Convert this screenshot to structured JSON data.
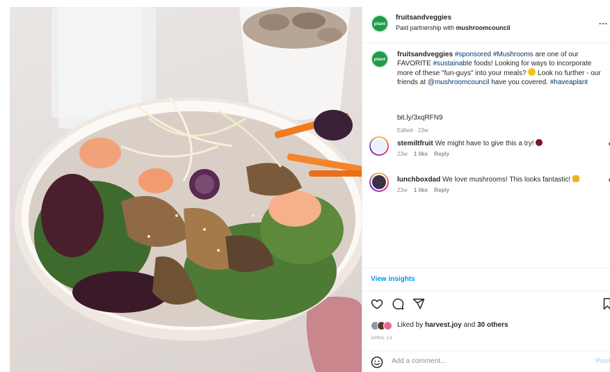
{
  "post": {
    "author": {
      "username": "fruitsandveggies",
      "avatar_text": "plant",
      "avatar_color": "#1f9a48"
    },
    "partnership_prefix": "Paid partnership with",
    "partner": "mushroomcouncil",
    "more_icon_label": "...",
    "caption": {
      "username": "fruitsandveggies",
      "part1": "#sponsored",
      "part2": "#Mushrooms",
      "text1": "are one of our FAVORITE",
      "part3": "#sustainable",
      "text2": "foods! Looking for ways to incorporate more of these \"fun-guys\" into your meals?",
      "text3": "Look no further - our friends at",
      "mention": "@mushroomcouncil",
      "text4": "have you covered.",
      "part4": "#haveaplant"
    },
    "link": "bit.ly/3xqRFN9",
    "edited": "Edited · 23w"
  },
  "comments": [
    {
      "username": "stemiltfruit",
      "text": "We might have to give this a try!",
      "time": "23w",
      "likes": "1 like",
      "reply": "Reply"
    },
    {
      "username": "lunchboxdad",
      "text": "We love mushrooms! This looks fantastic!",
      "time": "23w",
      "likes": "1 like",
      "reply": "Reply"
    }
  ],
  "insights_label": "View insights",
  "likes": {
    "prefix": "Liked by",
    "user": "harvest.joy",
    "middle": "and",
    "others": "30 others"
  },
  "date": "APRIL 13",
  "add_comment": {
    "placeholder": "Add a comment...",
    "post_label": "Post"
  },
  "colors": {
    "link_blue": "#0095f6",
    "hashtag": "#00376b",
    "muted": "#8e8e8e"
  }
}
